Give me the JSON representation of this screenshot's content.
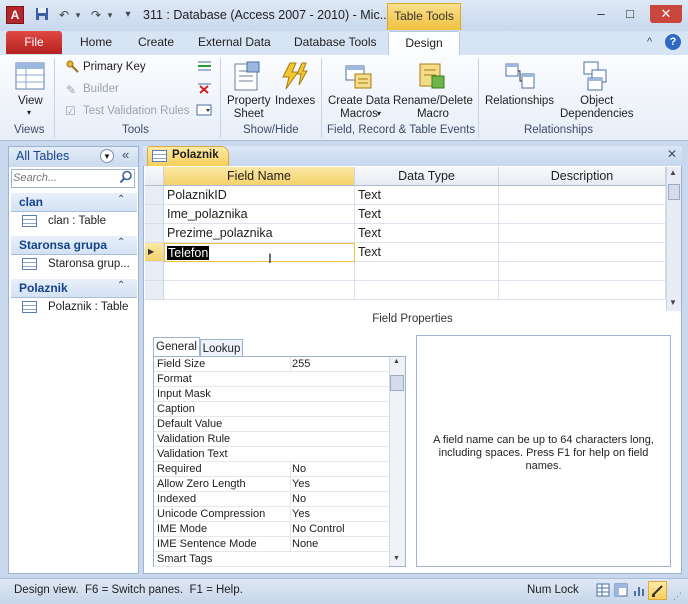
{
  "window": {
    "app_letter": "A",
    "title": "311 : Database (Access 2007 - 2010) - Mic...",
    "context_tab": "Table Tools",
    "controls": {
      "minimize": "–",
      "maximize": "□",
      "close": "✕"
    }
  },
  "ribbon": {
    "file_tab": "File",
    "tabs": [
      "Home",
      "Create",
      "External Data",
      "Database Tools",
      "Design"
    ],
    "help_glyph": "?",
    "collapse_glyph": "^",
    "groups": {
      "views": {
        "label": "Views",
        "view_button": "View"
      },
      "tools": {
        "label": "Tools",
        "primary_key": "Primary Key",
        "builder": "Builder",
        "test_validation": "Test Validation Rules"
      },
      "show_hide": {
        "label": "Show/Hide",
        "property_sheet_1": "Property",
        "property_sheet_2": "Sheet",
        "indexes": "Indexes"
      },
      "field_record": {
        "label": "Field, Record & Table Events",
        "create_macros_1": "Create Data",
        "create_macros_2": "Macros",
        "rename_macro_1": "Rename/Delete",
        "rename_macro_2": "Macro"
      },
      "relationships": {
        "label": "Relationships",
        "relationships": "Relationships",
        "dependencies_1": "Object",
        "dependencies_2": "Dependencies"
      }
    }
  },
  "nav": {
    "title": "All Tables",
    "search_placeholder": "Search...",
    "groups": [
      {
        "label": "clan",
        "item": "clan : Table"
      },
      {
        "label": "Staronsa grupa",
        "item": "Staronsa grup..."
      },
      {
        "label": "Polaznik",
        "item": "Polaznik : Table"
      }
    ]
  },
  "document": {
    "tab_label": "Polaznik",
    "columns": [
      "Field Name",
      "Data Type",
      "Description"
    ],
    "rows": [
      {
        "field": "PolaznikID",
        "type": "Text",
        "desc": ""
      },
      {
        "field": "Ime_polaznika",
        "type": "Text",
        "desc": ""
      },
      {
        "field": "Prezime_polaznika",
        "type": "Text",
        "desc": ""
      },
      {
        "field": "Telefon",
        "type": "Text",
        "desc": ""
      }
    ]
  },
  "field_properties": {
    "title": "Field Properties",
    "tabs": [
      "General",
      "Lookup"
    ],
    "rows": [
      {
        "name": "Field Size",
        "value": "255"
      },
      {
        "name": "Format",
        "value": ""
      },
      {
        "name": "Input Mask",
        "value": ""
      },
      {
        "name": "Caption",
        "value": ""
      },
      {
        "name": "Default Value",
        "value": ""
      },
      {
        "name": "Validation Rule",
        "value": ""
      },
      {
        "name": "Validation Text",
        "value": ""
      },
      {
        "name": "Required",
        "value": "No"
      },
      {
        "name": "Allow Zero Length",
        "value": "Yes"
      },
      {
        "name": "Indexed",
        "value": "No"
      },
      {
        "name": "Unicode Compression",
        "value": "Yes"
      },
      {
        "name": "IME Mode",
        "value": "No Control"
      },
      {
        "name": "IME Sentence Mode",
        "value": "None"
      },
      {
        "name": "Smart Tags",
        "value": ""
      }
    ],
    "help": "A field name can be up to 64 characters long, including spaces. Press F1 for help on field names."
  },
  "status": {
    "left": "Design view.  F6 = Switch panes.  F1 = Help.",
    "num_lock": "Num Lock"
  },
  "colors": {
    "file_tab": "#c42b27",
    "context_tab": "#f0c040",
    "selected_row": "#f7cf5a",
    "nav_header": "#15428b"
  }
}
